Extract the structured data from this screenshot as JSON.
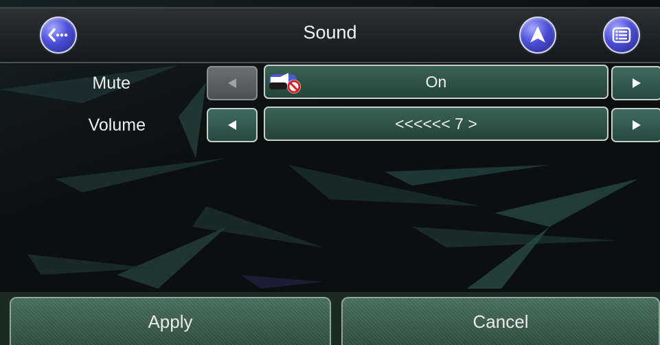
{
  "header": {
    "title": "Sound",
    "back_icon": "back-dots-icon",
    "navigate_icon": "navigation-arrow-icon",
    "menu_icon": "list-menu-icon"
  },
  "settings": {
    "mute": {
      "label": "Mute",
      "value": "On",
      "icon": "speaker-muted-icon",
      "left_enabled": false
    },
    "volume": {
      "label": "Volume",
      "value": "<<<<<< 7 >",
      "left_enabled": true
    }
  },
  "footer": {
    "apply_label": "Apply",
    "cancel_label": "Cancel"
  },
  "colors": {
    "accent": "#2f5a4c",
    "button_blue": "#4c4fd6",
    "text": "#f0f0f0"
  }
}
